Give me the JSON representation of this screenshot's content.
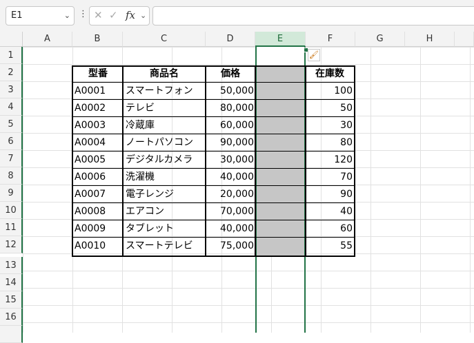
{
  "name_box": {
    "value": "E1"
  },
  "formula_bar": {
    "cancel_icon": "✕",
    "enter_icon": "✓",
    "fx_label": "fx",
    "value": ""
  },
  "columns": [
    "A",
    "B",
    "C",
    "D",
    "E",
    "F",
    "G",
    "H"
  ],
  "selected_column": "E",
  "rows": [
    "1",
    "2",
    "3",
    "4",
    "5",
    "6",
    "7",
    "8",
    "9",
    "10",
    "11",
    "12",
    "13",
    "14",
    "15",
    "16"
  ],
  "table": {
    "headers": {
      "model": "型番",
      "product": "商品名",
      "price": "価格",
      "stock": "在庫数"
    },
    "rows": [
      {
        "model": "A0001",
        "product": "スマートフォン",
        "price": "50,000",
        "stock": "100"
      },
      {
        "model": "A0002",
        "product": "テレビ",
        "price": "80,000",
        "stock": "50"
      },
      {
        "model": "A0003",
        "product": "冷蔵庫",
        "price": "60,000",
        "stock": "30"
      },
      {
        "model": "A0004",
        "product": "ノートパソコン",
        "price": "90,000",
        "stock": "80"
      },
      {
        "model": "A0005",
        "product": "デジタルカメラ",
        "price": "30,000",
        "stock": "120"
      },
      {
        "model": "A0006",
        "product": "洗濯機",
        "price": "40,000",
        "stock": "70"
      },
      {
        "model": "A0007",
        "product": "電子レンジ",
        "price": "20,000",
        "stock": "90"
      },
      {
        "model": "A0008",
        "product": "エアコン",
        "price": "70,000",
        "stock": "40"
      },
      {
        "model": "A0009",
        "product": "タブレット",
        "price": "40,000",
        "stock": "60"
      },
      {
        "model": "A0010",
        "product": "スマートテレビ",
        "price": "75,000",
        "stock": "55"
      }
    ]
  },
  "colors": {
    "accent": "#217346",
    "selection_fill": "#c6c6c6"
  },
  "icons": {
    "paste_options": "paintbrush-icon"
  }
}
